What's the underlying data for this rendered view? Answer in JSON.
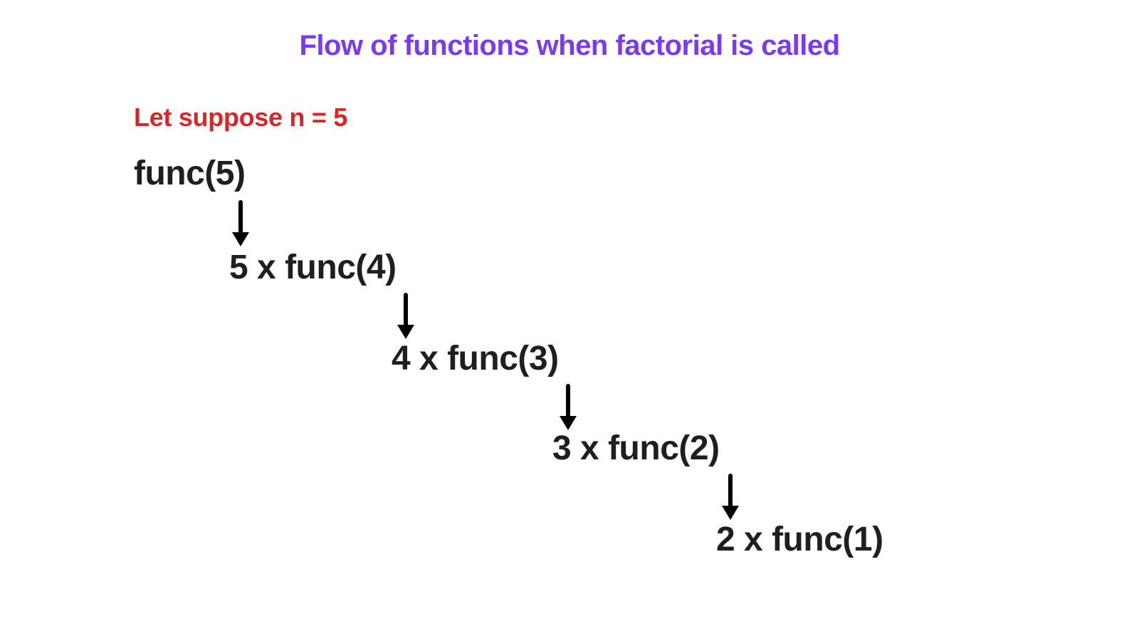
{
  "title": "Flow of functions when factorial is called",
  "suppose": "Let suppose n = 5",
  "steps": {
    "s0": "func(5)",
    "s1": "5 x func(4)",
    "s2": "4 x func(3)",
    "s3": "3 x func(2)",
    "s4": "2 x func(1)"
  }
}
